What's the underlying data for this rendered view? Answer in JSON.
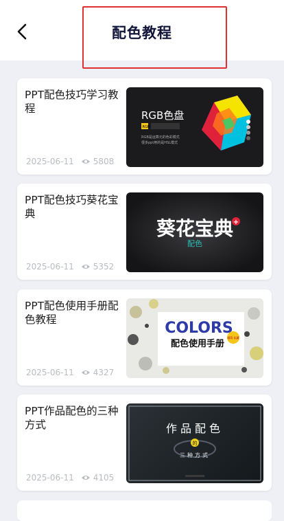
{
  "header": {
    "title": "配色教程"
  },
  "articles": [
    {
      "title": "PPT配色技巧学习教程",
      "date": "2025-06-11",
      "views": "5808",
      "thumb": {
        "heading": "RGB色盘",
        "badge": "RGB",
        "line1": "RGB是运算元的色彩模式",
        "line2": "很多ppt用的是HSL模式"
      }
    },
    {
      "title": "PPT配色技巧葵花宝典",
      "date": "2025-06-11",
      "views": "5352",
      "thumb": {
        "heading": "葵花宝典",
        "sub": "配色",
        "plus": "+"
      }
    },
    {
      "title": "PPT配色使用手册配色教程",
      "date": "2025-06-11",
      "views": "4327",
      "thumb": {
        "heading": "COLORS",
        "sub": "配色使用手册",
        "tag": "精简 私藏"
      }
    },
    {
      "title": "PPT作品配色的三种方式",
      "date": "2025-06-11",
      "views": "4105",
      "thumb": {
        "heading": "作品配色",
        "mid": "的",
        "sub": "三种方式"
      }
    }
  ],
  "colors": {
    "accent_red": "#e02f2f",
    "title": "#12153a",
    "meta": "#b9bcc3"
  }
}
